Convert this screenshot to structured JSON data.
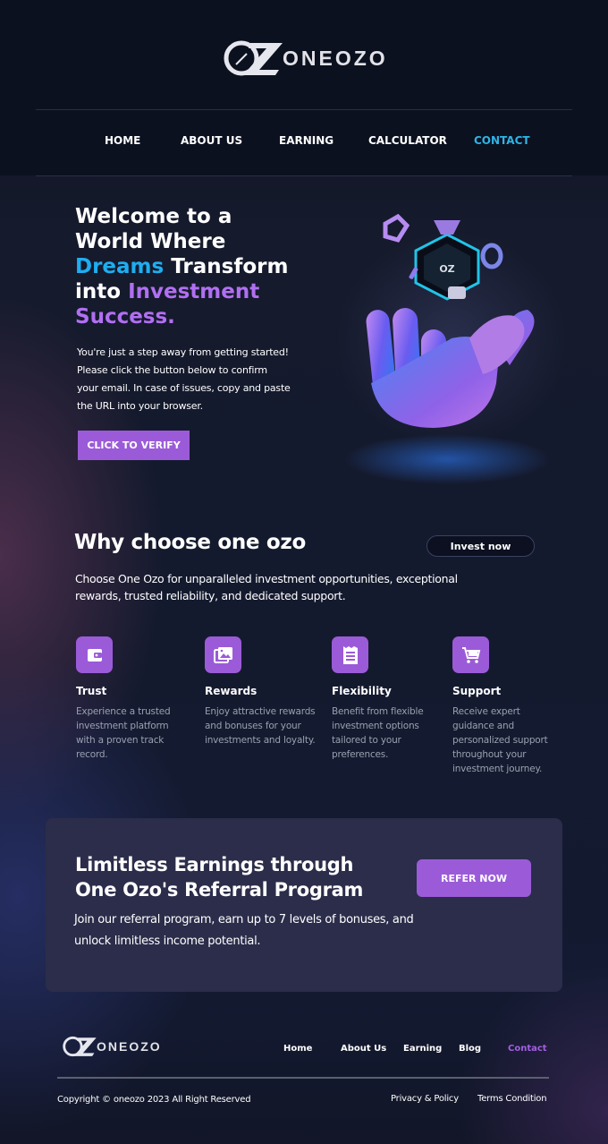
{
  "brand": {
    "logo_text": "ONEOZO",
    "logo_mark": "OZ"
  },
  "nav": {
    "items": [
      {
        "label": "HOME"
      },
      {
        "label": "ABOUT US"
      },
      {
        "label": "EARNING"
      },
      {
        "label": "CALCULATOR"
      },
      {
        "label": "CONTACT",
        "active": true
      }
    ]
  },
  "hero": {
    "title_line1": "Welcome to a",
    "title_line2": "World Where",
    "title_dreams": "Dreams",
    "title_transform": " Transform",
    "title_into": "into ",
    "title_investment": "Investment",
    "title_success": "Success.",
    "text": "You're just a step away from getting started! Please click the button below to confirm your email. In case of issues, copy and paste the URL into your browser.",
    "button_label": "CLICK TO VERIFY",
    "art_icon": "crystal-hand-with-oz-coin"
  },
  "why": {
    "title": "Why choose one ozo",
    "invest_button": "Invest now",
    "text": "Choose One Ozo for unparalleled investment opportunities, exceptional rewards, trusted reliability, and dedicated support.",
    "features": [
      {
        "title": "Trust",
        "desc": "Experience a trusted investment platform with a proven track record.",
        "icon": "wallet-icon"
      },
      {
        "title": "Rewards",
        "desc": "Enjoy attractive rewards and bonuses for your investments and loyalty.",
        "icon": "image-gallery-icon"
      },
      {
        "title": "Flexibility",
        "desc": "Benefit from flexible investment options tailored to your preferences.",
        "icon": "receipt-icon"
      },
      {
        "title": "Support",
        "desc": "Receive expert guidance and personalized support throughout your investment journey.",
        "icon": "cart-icon"
      }
    ]
  },
  "referral": {
    "title": "Limitless Earnings through One Ozo's Referral Program",
    "text": "Join our referral program, earn up to 7 levels of bonuses, and unlock limitless income potential.",
    "button_label": "REFER NOW"
  },
  "footer": {
    "logo_text": "ONEOZO",
    "links": [
      {
        "label": "Home"
      },
      {
        "label": "About Us"
      },
      {
        "label": "Earning"
      },
      {
        "label": "Blog"
      },
      {
        "label": "Contact",
        "active": true
      }
    ],
    "copyright": "Copyright © oneozo 2023 All Right Reserved",
    "privacy": "Privacy & Policy",
    "terms": "Terms Condition"
  },
  "colors": {
    "accent_purple": "#9b5bd8",
    "accent_blue": "#1eaef0",
    "nav_active": "#2fb4e6",
    "background": "#0d1120",
    "card": "#2b2d4a"
  }
}
